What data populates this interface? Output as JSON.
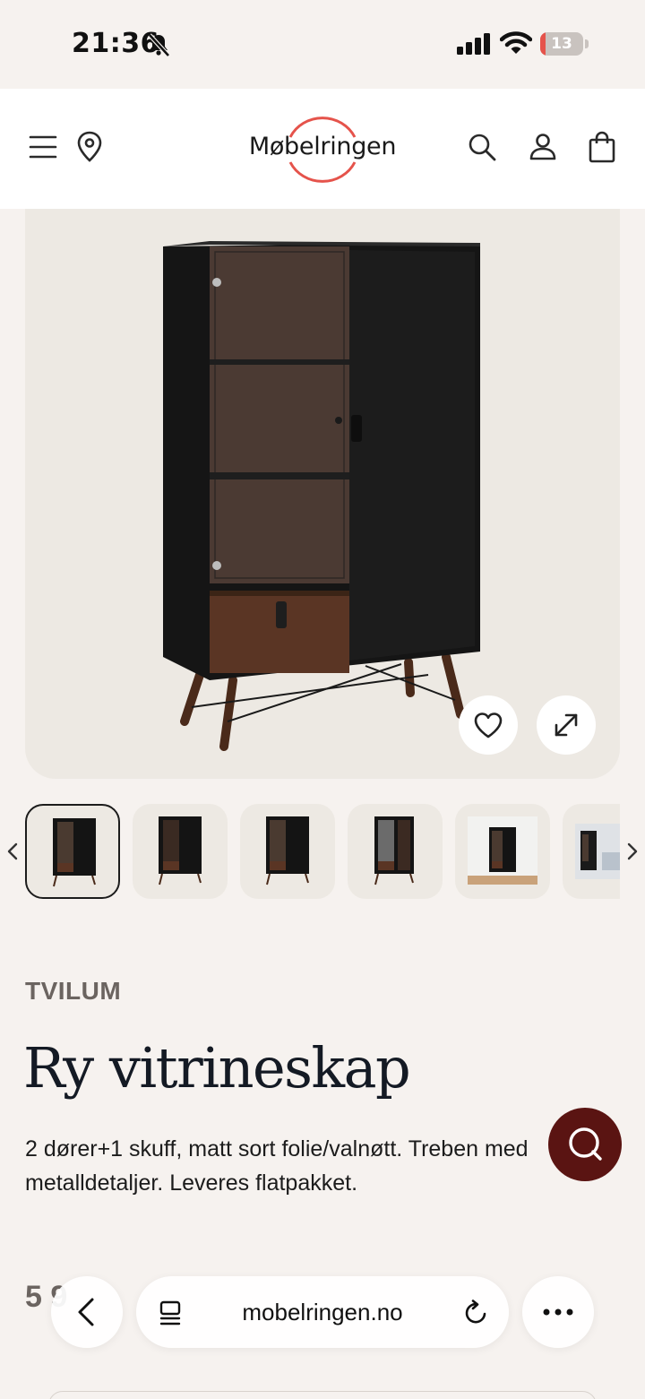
{
  "status_bar": {
    "time": "21:36",
    "battery": "13",
    "battery_level": 0.13
  },
  "header": {
    "logo_text": "Møbelringen",
    "brand_color": "#e5534b",
    "icons": [
      "menu-icon",
      "location-pin-icon",
      "search-icon",
      "user-icon",
      "shopping-bag-icon"
    ]
  },
  "gallery": {
    "thumbnail_count": 6,
    "active_index": 0
  },
  "product": {
    "brand": "TVILUM",
    "title": "Ry vitrineskap",
    "description_line1": "2 dører+1 skuff, matt sort folie/valnøtt. Treben med",
    "description_line2": "metalldetaljer. Leveres flatpakket.",
    "price": "5 9"
  },
  "browser": {
    "url": "mobelringen.no"
  },
  "colors": {
    "background": "#f6f2ef",
    "image_bg": "#ede9e3",
    "chat_button": "#5a1412"
  }
}
